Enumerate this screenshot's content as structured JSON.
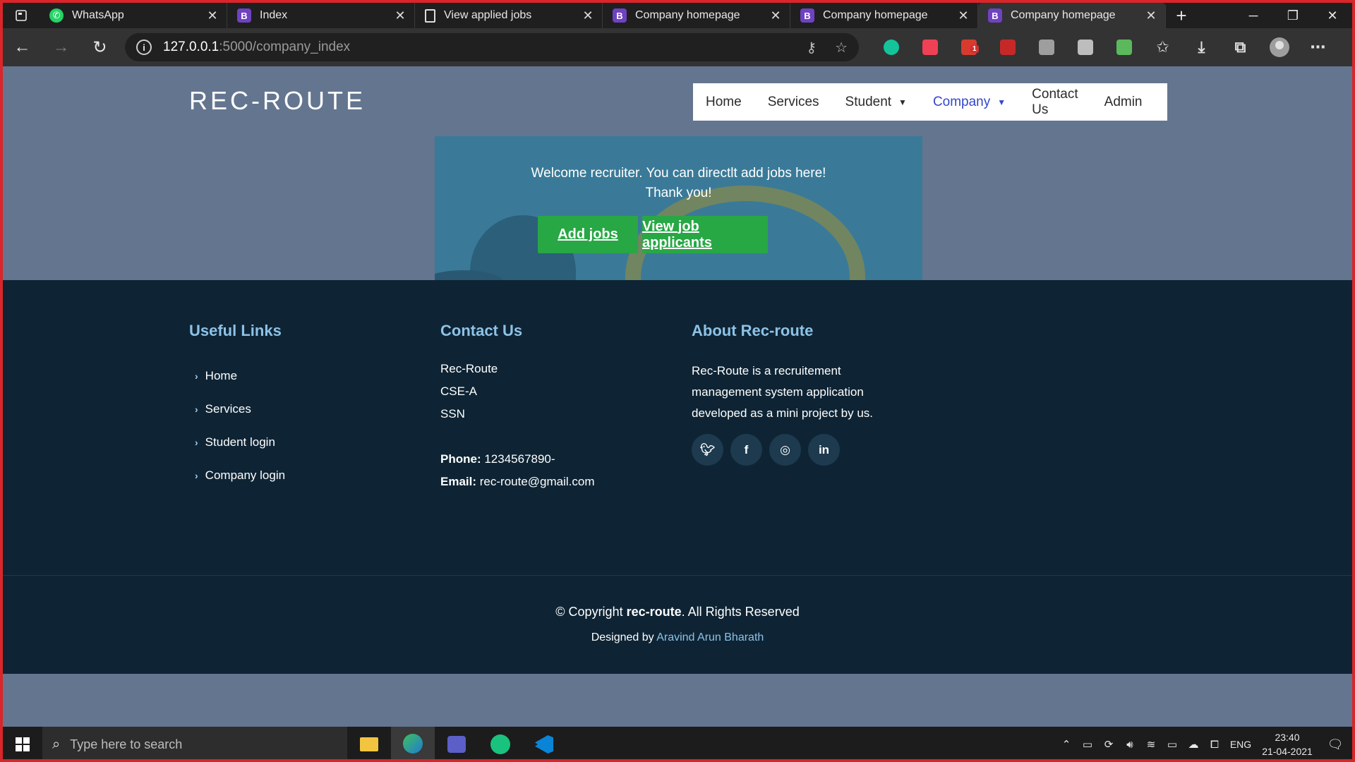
{
  "browser": {
    "tabs": [
      {
        "title": "WhatsApp",
        "favicon": "whatsapp-icon",
        "active": false
      },
      {
        "title": "Index",
        "favicon": "bootstrap-icon",
        "active": false
      },
      {
        "title": "View applied jobs",
        "favicon": "document-icon",
        "active": false
      },
      {
        "title": "Company homepage",
        "favicon": "bootstrap-icon",
        "active": false
      },
      {
        "title": "Company homepage",
        "favicon": "bootstrap-icon",
        "active": false
      },
      {
        "title": "Company homepage",
        "favicon": "bootstrap-icon",
        "active": true
      }
    ],
    "favicon_letter": "B",
    "address": {
      "host": "127.0.0.1",
      "path": ":5000/company_index"
    },
    "extension_badge": "1"
  },
  "site": {
    "brand": "REC-ROUTE",
    "nav": [
      "Home",
      "Services",
      "Student",
      "Company",
      "Contact Us",
      "Admin"
    ],
    "active_nav": "Company",
    "hero": {
      "line1": "Welcome recruiter. You can directlt add jobs here!",
      "line2": "Thank you!",
      "add_jobs": "Add jobs",
      "view_applicants": "View job applicants"
    },
    "footer": {
      "links_title": "Useful Links",
      "links": [
        "Home",
        "Services",
        "Student login",
        "Company login"
      ],
      "contact_title": "Contact Us",
      "contact_lines": [
        "Rec-Route",
        "CSE-A",
        "SSN"
      ],
      "phone_label": "Phone:",
      "phone": "1234567890-",
      "email_label": "Email:",
      "email": "rec-route@gmail.com",
      "about_title": "About Rec-route",
      "about_text": "Rec-Route is a recruitement management system application developed as a mini project by us.",
      "social": [
        "twitter-icon",
        "facebook-icon",
        "instagram-icon",
        "linkedin-icon"
      ],
      "copyright_prefix": "© Copyright",
      "copyright_name": "rec-route",
      "copyright_suffix": ". All Rights Reserved",
      "designed_by_label": "Designed by",
      "designed_by": "Aravind Arun Bharath"
    }
  },
  "taskbar": {
    "search_placeholder": "Type here to search",
    "language": "ENG",
    "time": "23:40",
    "date": "21-04-2021"
  },
  "colors": {
    "page_bg": "#64758f",
    "hero_bg": "#3a7a98",
    "button_green": "#28a745",
    "footer_bg": "#0e2434",
    "footer_heading": "#8ec2e6",
    "nav_active": "#3547c9",
    "frame_border": "#d8262b"
  }
}
